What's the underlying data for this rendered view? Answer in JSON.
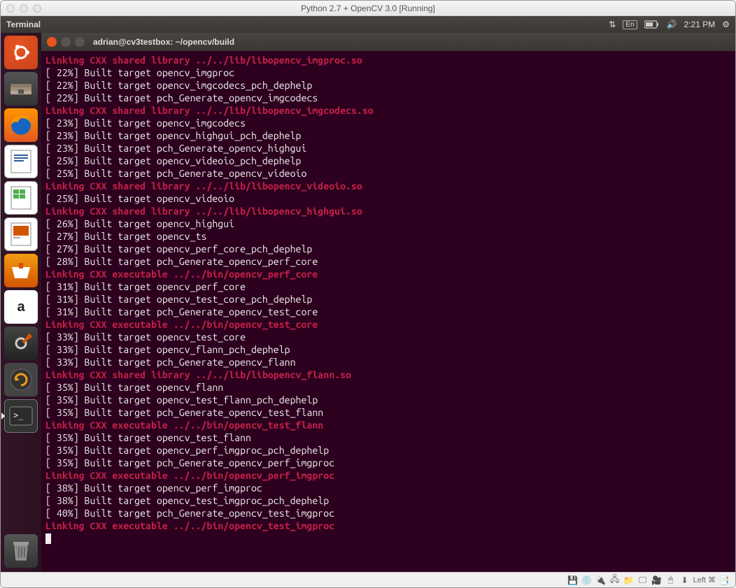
{
  "mac": {
    "title": "Python 2.7 + OpenCV 3.0 [Running]"
  },
  "menubar": {
    "app": "Terminal",
    "lang": "En",
    "time": "2:21 PM"
  },
  "terminal": {
    "title": "adrian@cv3testbox: ~/opencv/build",
    "lines": [
      {
        "type": "link",
        "text": "Linking CXX shared library ../../lib/libopencv_imgproc.so"
      },
      {
        "type": "build",
        "text": "[ 22%] Built target opencv_imgproc"
      },
      {
        "type": "build",
        "text": "[ 22%] Built target opencv_imgcodecs_pch_dephelp"
      },
      {
        "type": "build",
        "text": "[ 22%] Built target pch_Generate_opencv_imgcodecs"
      },
      {
        "type": "link",
        "text": "Linking CXX shared library ../../lib/libopencv_imgcodecs.so"
      },
      {
        "type": "build",
        "text": "[ 23%] Built target opencv_imgcodecs"
      },
      {
        "type": "build",
        "text": "[ 23%] Built target opencv_highgui_pch_dephelp"
      },
      {
        "type": "build",
        "text": "[ 23%] Built target pch_Generate_opencv_highgui"
      },
      {
        "type": "build",
        "text": "[ 25%] Built target opencv_videoio_pch_dephelp"
      },
      {
        "type": "build",
        "text": "[ 25%] Built target pch_Generate_opencv_videoio"
      },
      {
        "type": "link",
        "text": "Linking CXX shared library ../../lib/libopencv_videoio.so"
      },
      {
        "type": "build",
        "text": "[ 25%] Built target opencv_videoio"
      },
      {
        "type": "link",
        "text": "Linking CXX shared library ../../lib/libopencv_highgui.so"
      },
      {
        "type": "build",
        "text": "[ 26%] Built target opencv_highgui"
      },
      {
        "type": "build",
        "text": "[ 27%] Built target opencv_ts"
      },
      {
        "type": "build",
        "text": "[ 27%] Built target opencv_perf_core_pch_dephelp"
      },
      {
        "type": "build",
        "text": "[ 28%] Built target pch_Generate_opencv_perf_core"
      },
      {
        "type": "link",
        "text": "Linking CXX executable ../../bin/opencv_perf_core"
      },
      {
        "type": "build",
        "text": "[ 31%] Built target opencv_perf_core"
      },
      {
        "type": "build",
        "text": "[ 31%] Built target opencv_test_core_pch_dephelp"
      },
      {
        "type": "build",
        "text": "[ 31%] Built target pch_Generate_opencv_test_core"
      },
      {
        "type": "link",
        "text": "Linking CXX executable ../../bin/opencv_test_core"
      },
      {
        "type": "build",
        "text": "[ 33%] Built target opencv_test_core"
      },
      {
        "type": "build",
        "text": "[ 33%] Built target opencv_flann_pch_dephelp"
      },
      {
        "type": "build",
        "text": "[ 33%] Built target pch_Generate_opencv_flann"
      },
      {
        "type": "link",
        "text": "Linking CXX shared library ../../lib/libopencv_flann.so"
      },
      {
        "type": "build",
        "text": "[ 35%] Built target opencv_flann"
      },
      {
        "type": "build",
        "text": "[ 35%] Built target opencv_test_flann_pch_dephelp"
      },
      {
        "type": "build",
        "text": "[ 35%] Built target pch_Generate_opencv_test_flann"
      },
      {
        "type": "link",
        "text": "Linking CXX executable ../../bin/opencv_test_flann"
      },
      {
        "type": "build",
        "text": "[ 35%] Built target opencv_test_flann"
      },
      {
        "type": "build",
        "text": "[ 35%] Built target opencv_perf_imgproc_pch_dephelp"
      },
      {
        "type": "build",
        "text": "[ 35%] Built target pch_Generate_opencv_perf_imgproc"
      },
      {
        "type": "link",
        "text": "Linking CXX executable ../../bin/opencv_perf_imgproc"
      },
      {
        "type": "build",
        "text": "[ 38%] Built target opencv_perf_imgproc"
      },
      {
        "type": "build",
        "text": "[ 38%] Built target opencv_test_imgproc_pch_dephelp"
      },
      {
        "type": "build",
        "text": "[ 40%] Built target pch_Generate_opencv_test_imgproc"
      },
      {
        "type": "link",
        "text": "Linking CXX executable ../../bin/opencv_test_imgproc"
      }
    ]
  },
  "launcher": {
    "items": [
      {
        "name": "ubuntu-dash",
        "glyph": "◌"
      },
      {
        "name": "files",
        "glyph": "🗄"
      },
      {
        "name": "firefox",
        "glyph": "🦊"
      },
      {
        "name": "libreoffice-writer",
        "glyph": "📄"
      },
      {
        "name": "libreoffice-calc",
        "glyph": "📊"
      },
      {
        "name": "libreoffice-impress",
        "glyph": "📑"
      },
      {
        "name": "ubuntu-software",
        "glyph": "🛍"
      },
      {
        "name": "amazon",
        "glyph": "a"
      },
      {
        "name": "system-settings",
        "glyph": "⚙"
      },
      {
        "name": "software-updater",
        "glyph": "⟳"
      },
      {
        "name": "terminal",
        "glyph": ">_"
      },
      {
        "name": "trash",
        "glyph": "🗑"
      }
    ]
  },
  "vbstatus": {
    "host_key": "Left ⌘"
  }
}
